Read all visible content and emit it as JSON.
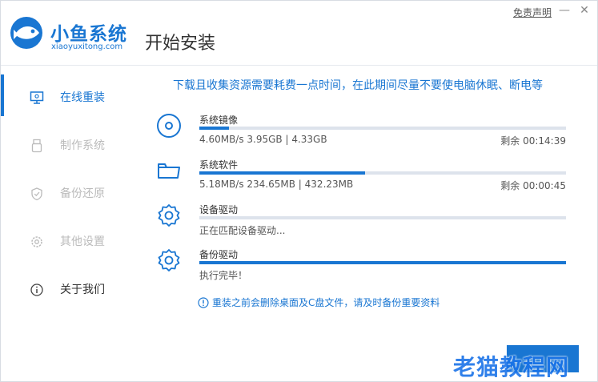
{
  "header": {
    "brand_name": "小鱼系统",
    "brand_sub": "xiaoyuxitong.com",
    "page_title": "开始安装",
    "disclaimer": "免责声明",
    "minimize": "—",
    "close": "✕"
  },
  "sidebar": {
    "items": [
      {
        "label": "在线重装",
        "icon": "monitor-icon",
        "state": "active"
      },
      {
        "label": "制作系统",
        "icon": "usb-icon",
        "state": "disabled"
      },
      {
        "label": "备份还原",
        "icon": "backup-icon",
        "state": "disabled"
      },
      {
        "label": "其他设置",
        "icon": "gear-icon",
        "state": "disabled"
      },
      {
        "label": "关于我们",
        "icon": "info-icon",
        "state": "normal"
      }
    ]
  },
  "main": {
    "notice": "下载且收集资源需要耗费一点时间，在此期间尽量不要使电脑休眠、断电等",
    "tasks": [
      {
        "name": "系统镜像",
        "stat": "4.60MB/s 3.95GB | 4.33GB",
        "remaining": "剩余 00:14:39",
        "progress": 0.08,
        "icon": "disc-icon"
      },
      {
        "name": "系统软件",
        "stat": "5.18MB/s 234.65MB | 432.23MB",
        "remaining": "剩余 00:00:45",
        "progress": 0.452,
        "icon": "folder-icon"
      },
      {
        "name": "设备驱动",
        "stat": "正在匹配设备驱动...",
        "remaining": "",
        "progress": 0.0,
        "icon": "gear-icon"
      },
      {
        "name": "备份驱动",
        "stat": "执行完毕！",
        "remaining": "",
        "progress": 1.0,
        "icon": "gear-icon"
      }
    ],
    "warning": "重装之前会删除桌面及C盘文件，请及时备份重要资料"
  },
  "footer": {
    "next_label": "",
    "watermark": "老猫教程网"
  },
  "colors": {
    "accent": "#1976d2",
    "track": "#dde3ec",
    "disabled": "#bbbbbb"
  }
}
